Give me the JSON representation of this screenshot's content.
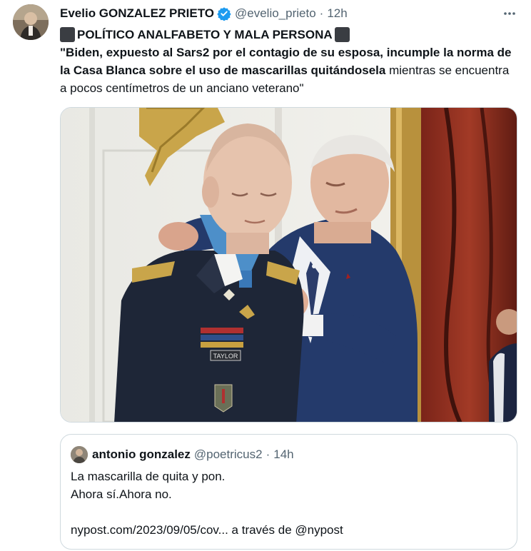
{
  "tweet": {
    "display_name": "Evelio GONZALEZ PRIETO",
    "handle": "@evelio_prieto",
    "separator": "·",
    "time": "12h",
    "verified_icon": "verified-badge-icon",
    "more_icon": "more-options-icon",
    "headline": "POLÍTICO ANALFABETO Y MALA PERSONA",
    "text_bold": "\"Biden, expuesto al Sars2 por el contagio de su esposa, incumple la norma de la Casa Blanca sobre el uso de mascarillas quitándosela",
    "text_regular": " mientras se encuentra a pocos centímetros de un anciano veterano\"",
    "media_label": "TAYLOR",
    "colors": {
      "accent": "#1d9bf0",
      "text": "#0f1419",
      "secondary": "#536471",
      "border": "#cfd9de"
    }
  },
  "quote": {
    "display_name": "antonio gonzalez",
    "handle": "@poetricus2",
    "separator": "·",
    "time": "14h",
    "line1": "La mascarilla de quita y pon.",
    "line2": "Ahora sí.Ahora no.",
    "link_text": "nypost.com/2023/09/05/cov... a través de @nypost"
  }
}
